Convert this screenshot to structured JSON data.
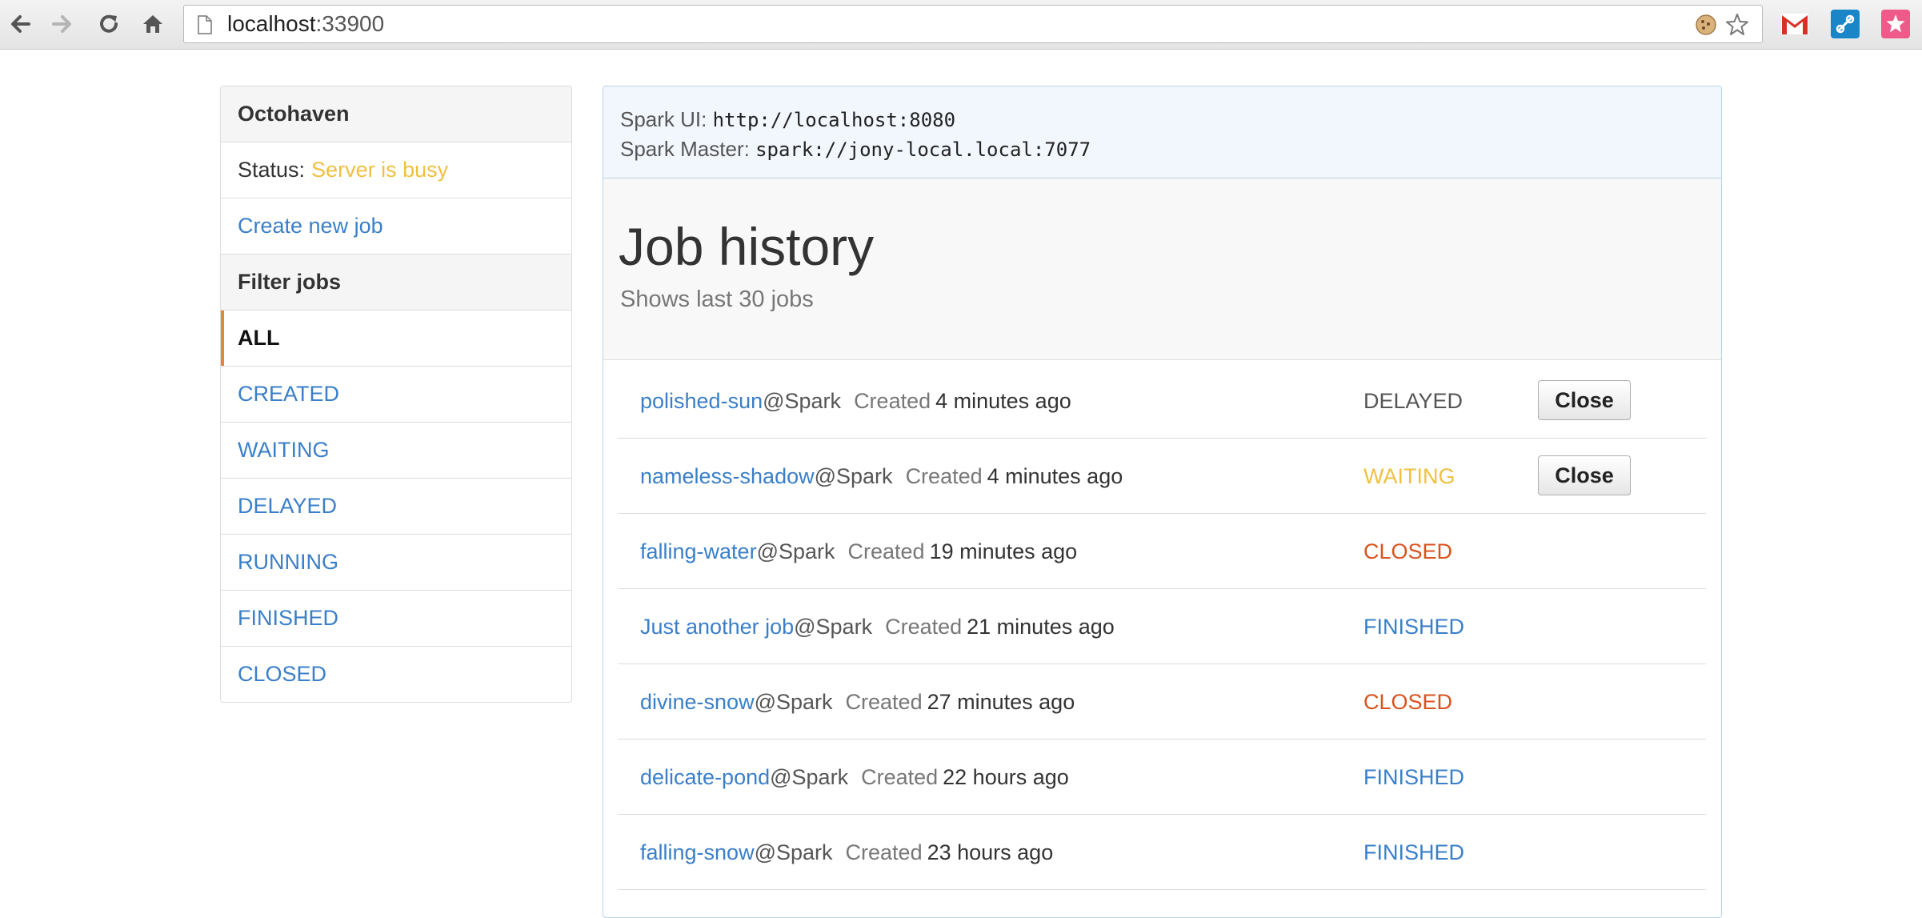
{
  "browser": {
    "url_host": "localhost",
    "url_port": ":33900"
  },
  "sidebar": {
    "title": "Octohaven",
    "status_label": "Status:",
    "status_value": "Server is busy",
    "create_job": "Create new job",
    "filter_heading": "Filter jobs",
    "filters": [
      {
        "label": "ALL",
        "active": true
      },
      {
        "label": "CREATED"
      },
      {
        "label": "WAITING"
      },
      {
        "label": "DELAYED"
      },
      {
        "label": "RUNNING"
      },
      {
        "label": "FINISHED"
      },
      {
        "label": "CLOSED"
      }
    ]
  },
  "info": {
    "spark_ui_label": "Spark UI:",
    "spark_ui_value": "http://localhost:8080",
    "spark_master_label": "Spark Master:",
    "spark_master_value": "spark://jony-local.local:7077"
  },
  "history": {
    "title": "Job history",
    "subtitle": "Shows last 30 jobs",
    "created_label": "Created",
    "close_label": "Close",
    "jobs": [
      {
        "name": "polished-sun",
        "suffix": "@Spark",
        "time": "4 minutes ago",
        "status": "DELAYED"
      },
      {
        "name": "nameless-shadow",
        "suffix": "@Spark",
        "time": "4 minutes ago",
        "status": "WAITING"
      },
      {
        "name": "falling-water",
        "suffix": "@Spark",
        "time": "19 minutes ago",
        "status": "CLOSED"
      },
      {
        "name": "Just another job",
        "suffix": "@Spark",
        "time": "21 minutes ago",
        "status": "FINISHED"
      },
      {
        "name": "divine-snow",
        "suffix": "@Spark",
        "time": "27 minutes ago",
        "status": "CLOSED"
      },
      {
        "name": "delicate-pond",
        "suffix": "@Spark",
        "time": "22 hours ago",
        "status": "FINISHED"
      },
      {
        "name": "falling-snow",
        "suffix": "@Spark",
        "time": "23 hours ago",
        "status": "FINISHED"
      }
    ]
  },
  "colors": {
    "link": "#3a7fc8",
    "busy": "#f0c040",
    "closed": "#d9531e",
    "active_marker": "#e08a2a"
  }
}
